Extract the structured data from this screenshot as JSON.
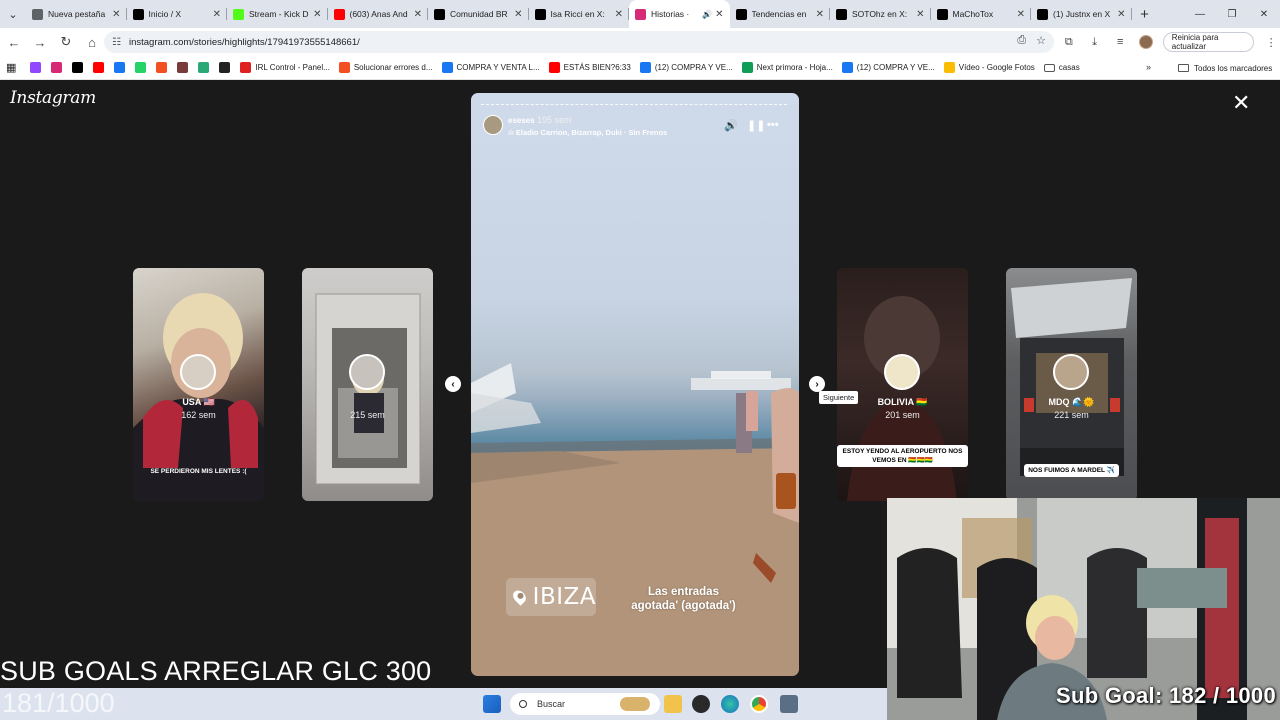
{
  "browser": {
    "tabs": [
      {
        "title": "Nueva pestaña",
        "icon": "chrome-icon",
        "color": "#5f6368"
      },
      {
        "title": "Inicio / X",
        "icon": "x-icon",
        "color": "#000000"
      },
      {
        "title": "Stream - Kick D",
        "icon": "kick-icon",
        "color": "#53fc18"
      },
      {
        "title": "(603) Anas And",
        "icon": "youtube-icon",
        "color": "#ff0000"
      },
      {
        "title": "Comunidad BR",
        "icon": "x-icon",
        "color": "#000000"
      },
      {
        "title": "Isa Ricci en X:",
        "icon": "x-icon",
        "color": "#000000"
      },
      {
        "title": "Historias ·",
        "icon": "instagram-icon",
        "color": "#d62976",
        "active": true
      },
      {
        "title": "Tendencias en",
        "icon": "x-icon",
        "color": "#000000"
      },
      {
        "title": "SOTOhz en X:",
        "icon": "x-icon",
        "color": "#000000"
      },
      {
        "title": "MaChoTox",
        "icon": "x-icon",
        "color": "#000000"
      },
      {
        "title": "(1) Justnx en X",
        "icon": "x-icon",
        "color": "#000000"
      }
    ],
    "url": "instagram.com/stories/highlights/17941973555148661/",
    "update_button": "Reinicia para actualizar",
    "bookmarks": [
      {
        "label": "",
        "icon": "twitch-icon",
        "color": "#9146ff"
      },
      {
        "label": "",
        "icon": "instagram-icon",
        "color": "#d62976"
      },
      {
        "label": "",
        "icon": "x-icon",
        "color": "#000000"
      },
      {
        "label": "",
        "icon": "youtube-icon",
        "color": "#ff0000"
      },
      {
        "label": "",
        "icon": "facebook-icon",
        "color": "#1877f2"
      },
      {
        "label": "",
        "icon": "whatsapp-icon",
        "color": "#25d366"
      },
      {
        "label": "",
        "icon": "microsoft-icon",
        "color": "#f25022"
      },
      {
        "label": "",
        "icon": "bookmark-image-icon",
        "color": "#7a3b3b"
      },
      {
        "label": "",
        "icon": "bookmark-green-icon",
        "color": "#2aa876"
      },
      {
        "label": "",
        "icon": "github-icon",
        "color": "#222222"
      },
      {
        "label": "IRL Control - Panel...",
        "icon": "irl-icon",
        "color": "#e02020"
      },
      {
        "label": "Solucionar errores d...",
        "icon": "microsoft-icon",
        "color": "#f25022"
      },
      {
        "label": "COMPRA Y VENTA L...",
        "icon": "facebook-icon",
        "color": "#1877f2"
      },
      {
        "label": "ESTÁS BIEN?6:33",
        "icon": "youtube-icon",
        "color": "#ff0000"
      },
      {
        "label": "(12) COMPRA Y VE...",
        "icon": "facebook-icon",
        "color": "#1877f2"
      },
      {
        "label": "Next primora - Hoja...",
        "icon": "sheets-icon",
        "color": "#0f9d58"
      },
      {
        "label": "(12) COMPRA Y VE...",
        "icon": "facebook-icon",
        "color": "#1877f2"
      },
      {
        "label": "Vídeo - Google Fotos",
        "icon": "photos-icon",
        "color": "#fbbc04"
      },
      {
        "label": "casas",
        "icon": "folder-icon",
        "color": "#555555"
      }
    ],
    "bookmarks_more": "»",
    "all_bookmarks": "Todos los marcadores"
  },
  "instagram": {
    "logo": "Instagram",
    "story": {
      "username": "eseses",
      "time": "195 sem",
      "music": "Eladio Carrion, Bizarrap, Duki · Sin Frenos",
      "location": "IBIZA",
      "caption_line1": "Las entradas",
      "caption_line2": "agotada' (agotada')"
    },
    "highlights": [
      {
        "name": "USA 🇺🇸",
        "time": "162 sem",
        "caption": "SE PERDIERON MIS LENTES :("
      },
      {
        "name": "",
        "time": "215 sem",
        "caption": ""
      },
      {
        "name": "BOLIVIA 🇧🇴",
        "time": "201 sem",
        "caption": "ESTOY YENDO AL AEROPUERTO NOS VEMOS EN 🇧🇴🇧🇴🇧🇴"
      },
      {
        "name": "MDQ 🌊🌞",
        "time": "221 sem",
        "caption": "NOS FUIMOS A MARDEL ✈️"
      }
    ],
    "next_tooltip": "Siguiente"
  },
  "stream_overlay": {
    "sub_goals_title": "SUB GOALS ARREGLAR GLC  300",
    "sub_goals_progress": "181/1000",
    "sub_goal_label": "Sub Goal:  182 / 1000",
    "sub_goal_current": 182,
    "sub_goal_target": 1000
  },
  "taskbar": {
    "search_placeholder": "Buscar"
  }
}
